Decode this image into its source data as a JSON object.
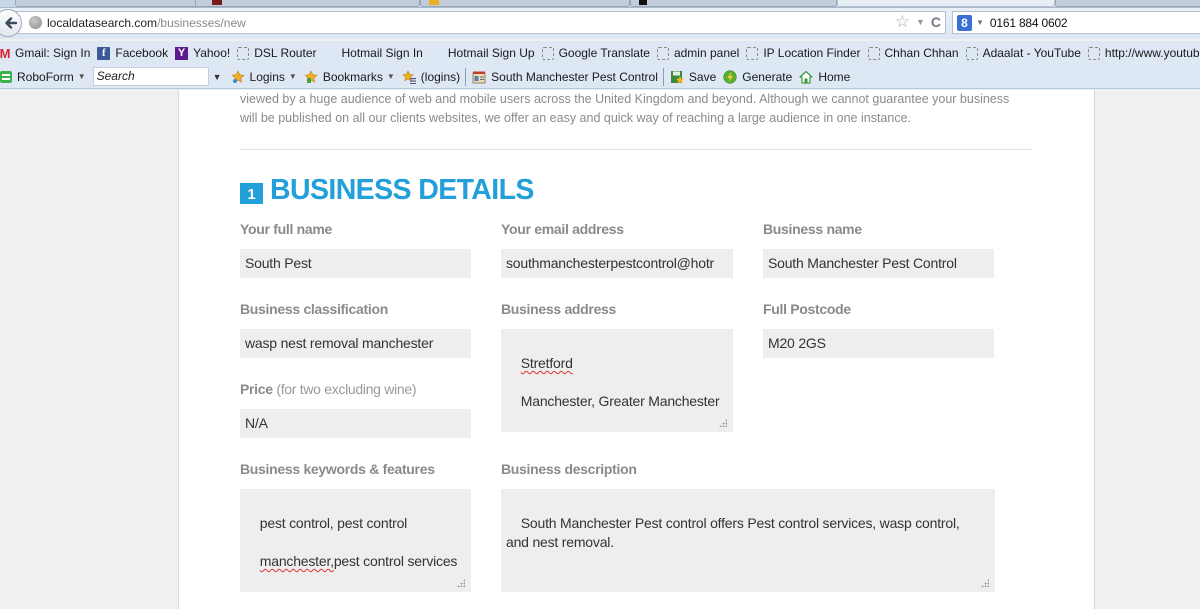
{
  "browser": {
    "url_domain": "localdatasearch.com",
    "url_path": "/businesses/new",
    "search_engine_icon": "g-icon",
    "search_value": "0161 884 0602"
  },
  "bookmarks": [
    {
      "label": "Gmail: Sign In",
      "icon": "gmail-icon"
    },
    {
      "label": "Facebook",
      "icon": "facebook-icon"
    },
    {
      "label": "Yahoo!",
      "icon": "yahoo-icon"
    },
    {
      "label": "DSL Router",
      "icon": "blank-page-icon"
    },
    {
      "label": "Hotmail Sign In",
      "icon": "windows-icon"
    },
    {
      "label": "Hotmail Sign Up",
      "icon": "windows-icon"
    },
    {
      "label": "Google Translate",
      "icon": "blank-page-icon"
    },
    {
      "label": "admin panel",
      "icon": "blank-page-icon"
    },
    {
      "label": "IP Location Finder",
      "icon": "blank-page-icon"
    },
    {
      "label": "Chhan Chhan",
      "icon": "blank-page-icon"
    },
    {
      "label": "Adaalat - YouTube",
      "icon": "blank-page-icon"
    },
    {
      "label": "http://www.youtube.c...",
      "icon": "blank-page-icon"
    }
  ],
  "roboform": {
    "brand": "RoboForm",
    "search_placeholder": "Search",
    "logins": "Logins",
    "bookmarks": "Bookmarks",
    "logins_paren": "(logins)",
    "current_identity": "South Manchester Pest Control",
    "save": "Save",
    "generate": "Generate",
    "home": "Home"
  },
  "page": {
    "intro_line1": "viewed by a huge audience of web and mobile users across the United Kingdom and beyond. Although we cannot guarantee your business",
    "intro_line2": "will be published on all our clients websites, we offer an easy and quick way of reaching a large audience in one instance.",
    "section_number": "1",
    "section_title": "BUSINESS DETAILS",
    "accent_color": "#239fd9"
  },
  "form": {
    "full_name": {
      "label": "Your full name",
      "value": "South Pest"
    },
    "email": {
      "label": "Your email address",
      "value": "southmanchesterpestcontrol@hotr"
    },
    "business_name": {
      "label": "Business name",
      "value": "South Manchester Pest Control"
    },
    "classification": {
      "label": "Business classification",
      "value": "wasp nest removal manchester"
    },
    "address": {
      "label": "Business address",
      "line1": "Stretford",
      "line2": "Manchester, Greater Manchester"
    },
    "postcode": {
      "label": "Full Postcode",
      "value": "M20 2GS"
    },
    "price": {
      "label": "Price",
      "sublabel": "(for two excluding wine)",
      "value": "N/A"
    },
    "keywords": {
      "label": "Business keywords & features",
      "line1": "pest control, pest control",
      "line2_misspelled": "manchester,",
      "line2_rest": "pest control services"
    },
    "description": {
      "label": "Business description",
      "value": "South Manchester Pest control offers Pest control services, wasp control,\nand nest removal."
    }
  }
}
